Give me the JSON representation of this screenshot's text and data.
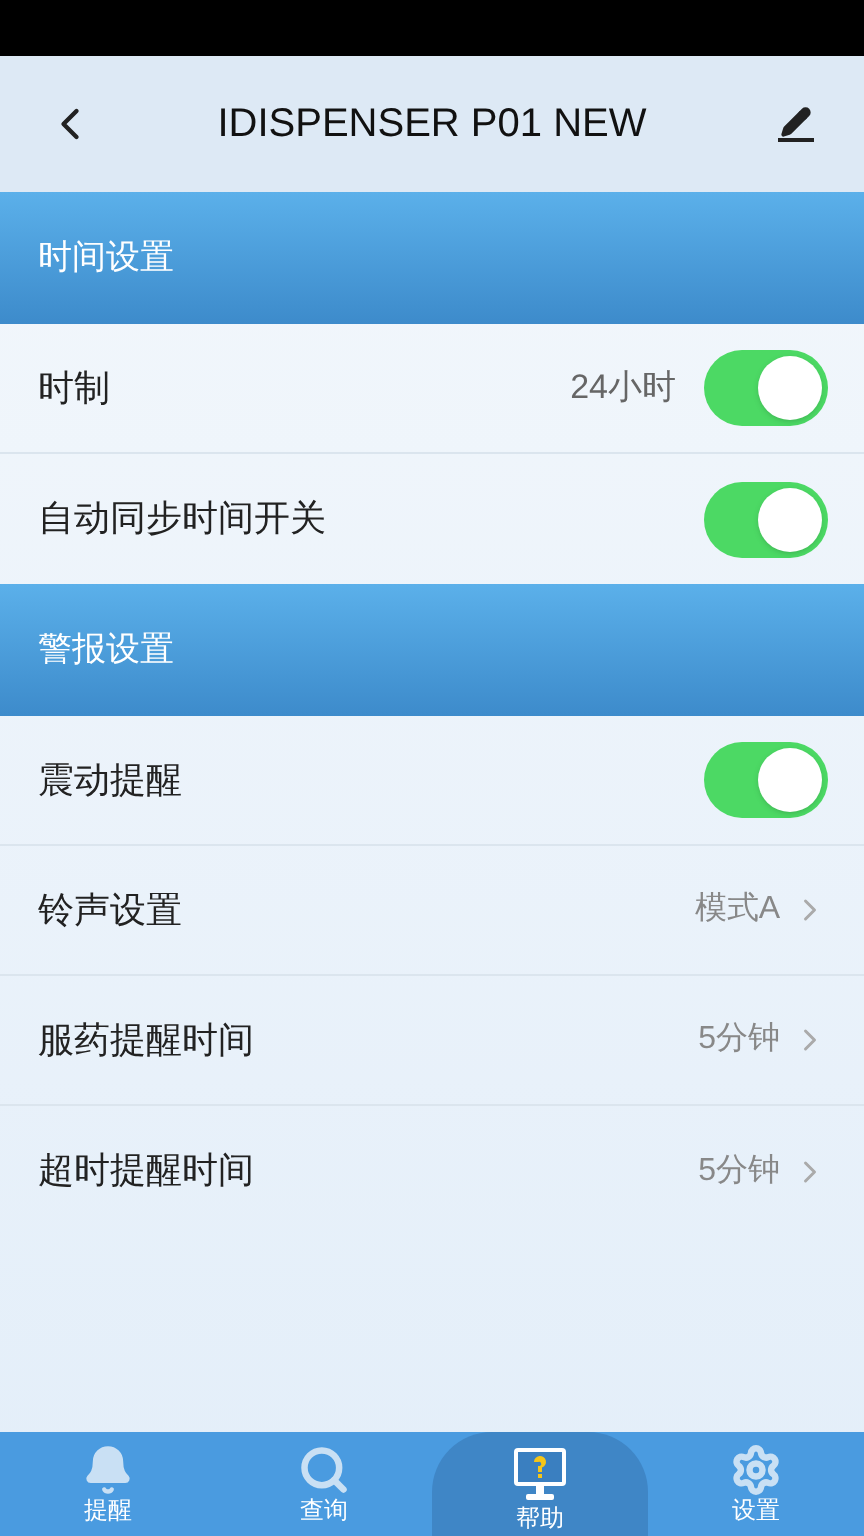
{
  "header": {
    "title": "IDISPENSER P01 NEW"
  },
  "sections": [
    {
      "title": "时间设置",
      "rows": [
        {
          "kind": "toggle",
          "label": "时制",
          "value": "24小时",
          "on": true
        },
        {
          "kind": "toggle",
          "label": "自动同步时间开关",
          "on": true
        }
      ]
    },
    {
      "title": "警报设置",
      "rows": [
        {
          "kind": "toggle",
          "label": "震动提醒",
          "on": true
        },
        {
          "kind": "link",
          "label": "铃声设置",
          "value": "模式A"
        },
        {
          "kind": "link",
          "label": "服药提醒时间",
          "value": "5分钟"
        },
        {
          "kind": "link",
          "label": "超时提醒时间",
          "value": "5分钟"
        }
      ]
    }
  ],
  "tabs": [
    {
      "label": "提醒",
      "kind": "bell",
      "selected": false
    },
    {
      "label": "查询",
      "kind": "search",
      "selected": false
    },
    {
      "label": "帮助",
      "kind": "help",
      "selected": true
    },
    {
      "label": "设置",
      "kind": "gear",
      "selected": false
    }
  ]
}
